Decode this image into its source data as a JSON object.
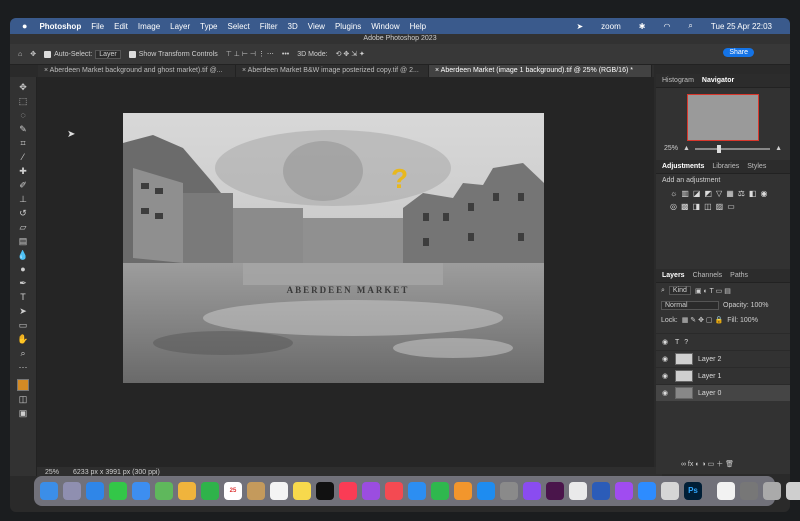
{
  "menubar": {
    "apple": "",
    "app": "Photoshop",
    "items": [
      "File",
      "Edit",
      "Image",
      "Layer",
      "Type",
      "Select",
      "Filter",
      "3D",
      "View",
      "Plugins",
      "Window",
      "Help"
    ],
    "zoom": "zoom",
    "datetime": "Tue 25 Apr  22:03"
  },
  "window": {
    "title": "Adobe Photoshop 2023"
  },
  "options": {
    "auto_select": "Auto-Select:",
    "layer_select": "Layer",
    "transform": "Show Transform Controls",
    "mode_3d": "3D Mode:",
    "share": "Share"
  },
  "tabs": [
    {
      "label": "Aberdeen Market background and ghost market).tif @..."
    },
    {
      "label": "Aberdeen Market B&W image posterized copy.tif @ 2..."
    },
    {
      "label": "Aberdeen Market (image 1 background).tif @ 25% (RGB/16) *"
    }
  ],
  "document": {
    "sign_text": "ABERDEEN MARKET",
    "question": "?"
  },
  "status": {
    "zoom": "25%",
    "dimensions": "6233 px x 3991 px (300 ppi)"
  },
  "panels": {
    "top_tabs": [
      "Histogram",
      "Navigator"
    ],
    "nav_zoom": "25%",
    "adj_tabs": [
      "Adjustments",
      "Libraries",
      "Styles"
    ],
    "adj_label": "Add an adjustment",
    "layers_tabs": [
      "Layers",
      "Channels",
      "Paths"
    ],
    "kind": "Kind",
    "blend": "Normal",
    "opacity": "Opacity: 100%",
    "lock": "Lock:",
    "fill": "Fill: 100%",
    "layers": [
      {
        "name": "?",
        "type": "T"
      },
      {
        "name": "Layer 2",
        "type": ""
      },
      {
        "name": "Layer 1",
        "type": ""
      },
      {
        "name": "Layer 0",
        "type": ""
      }
    ]
  },
  "dock": {
    "calendar": "25",
    "ps": "Ps"
  },
  "colors": {
    "accent": "#1473e6",
    "menubar": "#3a5a8c",
    "question": "#e8b81e",
    "foreground": "#d28a25"
  }
}
